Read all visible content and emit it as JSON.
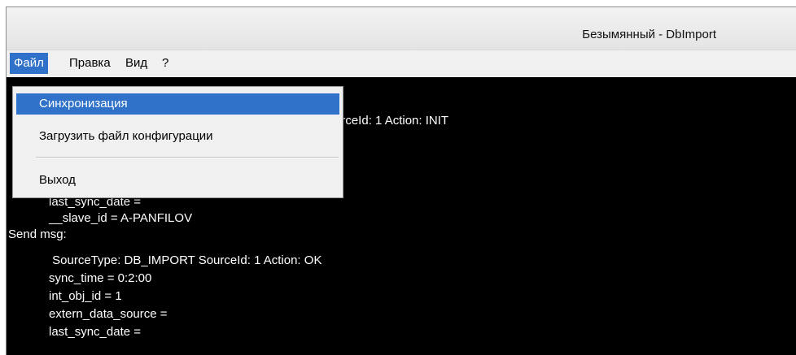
{
  "window": {
    "title": "Безымянный - DbImport"
  },
  "menubar": {
    "items": [
      "Файл",
      "Правка",
      "Вид",
      "?"
    ]
  },
  "file_menu": {
    "items": [
      "Синхронизация",
      "Загрузить файл конфигурации",
      "Выход"
    ]
  },
  "console": {
    "lines": [
      "urceId: 1 Action: INIT",
      "            last_sync_date =",
      "            __slave_id = A-PANFILOV",
      "Send msg:",
      "             SourceType: DB_IMPORT SourceId: 1 Action: OK",
      "            sync_time = 0:2:00",
      "            int_obj_id = 1",
      "            extern_data_source =",
      "            last_sync_date ="
    ]
  }
}
